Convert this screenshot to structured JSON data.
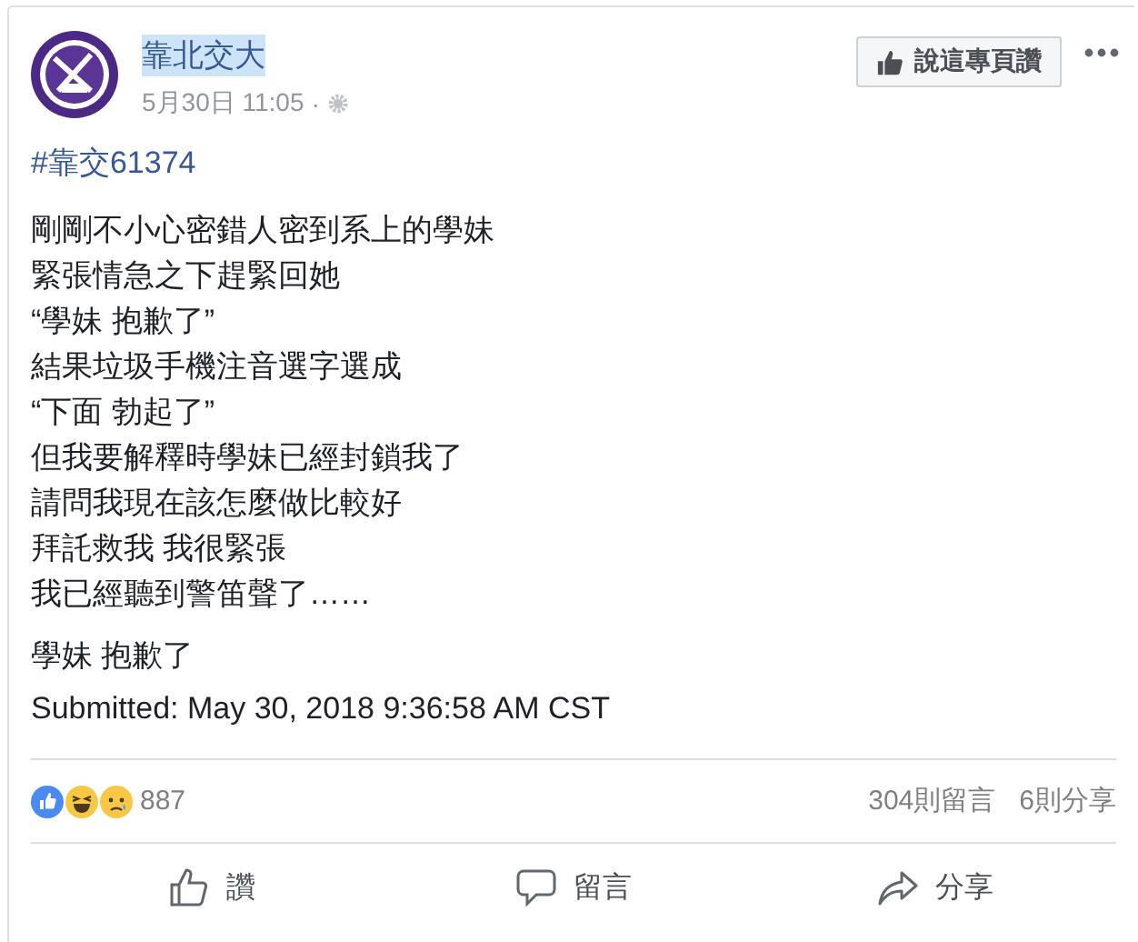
{
  "page": {
    "name": "靠北交大",
    "name_highlighted": true,
    "timestamp": "5月30日 11:05",
    "separator": "·"
  },
  "like_page_button": "說這專頁讚",
  "hashtag": "#靠交61374",
  "body_lines": [
    "剛剛不小心密錯人密到系上的學妹",
    "緊張情急之下趕緊回她",
    "“學妹 抱歉了”",
    "結果垃圾手機注音選字選成",
    "“下面 勃起了”",
    "但我要解釋時學妹已經封鎖我了",
    "請問我現在該怎麼做比較好",
    "拜託救我 我很緊張",
    "我已經聽到警笛聲了……"
  ],
  "closing_line": "學妹 抱歉了",
  "submitted": "Submitted: May 30, 2018 9:36:58 AM CST",
  "reactions": {
    "types": [
      {
        "kind": "like"
      },
      {
        "kind": "haha"
      },
      {
        "kind": "sad"
      }
    ],
    "count": "887"
  },
  "comments": "304則留言",
  "shares": "6則分享",
  "actions": [
    {
      "kind": "like",
      "label": "讚"
    },
    {
      "kind": "comment",
      "label": "留言"
    },
    {
      "kind": "share",
      "label": "分享"
    }
  ]
}
